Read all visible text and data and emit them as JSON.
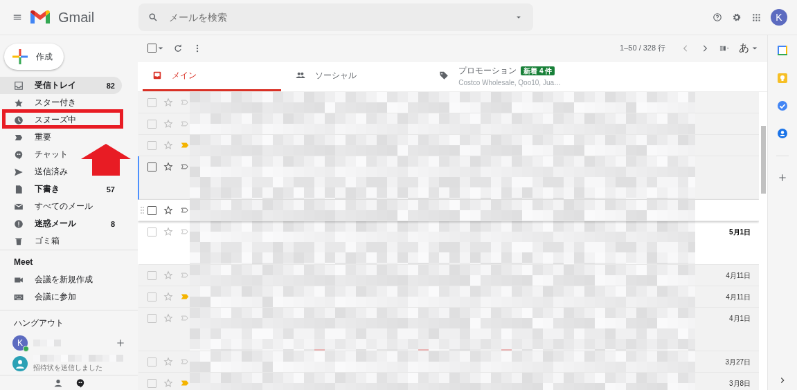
{
  "app": {
    "title": "Gmail"
  },
  "search": {
    "placeholder": "メールを検索"
  },
  "account": {
    "initial": "K"
  },
  "compose": {
    "label": "作成"
  },
  "nav": [
    {
      "kind": "inbox",
      "label": "受信トレイ",
      "count": "82",
      "selected": true,
      "unread": true
    },
    {
      "kind": "star",
      "label": "スター付き",
      "selected": false,
      "unread": false
    },
    {
      "kind": "snooze",
      "label": "スヌーズ中",
      "selected": false,
      "unread": false
    },
    {
      "kind": "important",
      "label": "重要",
      "selected": false,
      "unread": false
    },
    {
      "kind": "chat",
      "label": "チャット",
      "selected": false,
      "unread": false
    },
    {
      "kind": "sent",
      "label": "送信済み",
      "selected": false,
      "unread": false
    },
    {
      "kind": "draft",
      "label": "下書き",
      "count": "57",
      "selected": false,
      "unread": true
    },
    {
      "kind": "all",
      "label": "すべてのメール",
      "selected": false,
      "unread": false
    },
    {
      "kind": "spam",
      "label": "迷惑メール",
      "count": "8",
      "selected": false,
      "unread": true
    },
    {
      "kind": "trash",
      "label": "ゴミ箱",
      "selected": false,
      "unread": false
    }
  ],
  "meet": {
    "title": "Meet",
    "items": [
      {
        "kind": "video",
        "label": "会議を新規作成"
      },
      {
        "kind": "keyboard",
        "label": "会議に参加"
      }
    ]
  },
  "hangouts": {
    "title": "ハングアウト",
    "contacts": [
      {
        "kind": "self",
        "initial": "K",
        "online": true
      },
      {
        "kind": "invited",
        "status": "招待状を送信しました",
        "online": false
      }
    ]
  },
  "toolbar": {
    "select_all": false,
    "range": "1–50 / 328 行",
    "input_tool": "あ"
  },
  "tabs": [
    {
      "kind": "primary",
      "label": "メイン",
      "selected": true
    },
    {
      "kind": "social",
      "label": "ソーシャル",
      "selected": false
    },
    {
      "kind": "promotions",
      "label": "プロモーション",
      "badge": "新着 4 件",
      "subtitle": "Costco Wholesale, Qoo10, Jua…",
      "selected": false
    }
  ],
  "rows": [
    {
      "kind": "single",
      "important": false,
      "unread": false,
      "focused": false,
      "hovered": false
    },
    {
      "kind": "single",
      "important": false,
      "unread": false,
      "focused": false,
      "hovered": false
    },
    {
      "kind": "single",
      "important": true,
      "unread": false,
      "focused": false,
      "hovered": false
    },
    {
      "kind": "attachments",
      "important": false,
      "unread": false,
      "focused": true,
      "hovered": false
    },
    {
      "kind": "single",
      "important": false,
      "unread": false,
      "focused": false,
      "hovered": true
    },
    {
      "kind": "attachments",
      "important": false,
      "unread": true,
      "focused": false,
      "hovered": false,
      "date": "5月1日"
    },
    {
      "kind": "single",
      "important": false,
      "unread": false,
      "focused": false,
      "hovered": false,
      "date": "4月11日"
    },
    {
      "kind": "single",
      "important": true,
      "unread": false,
      "focused": false,
      "hovered": false,
      "date": "4月11日"
    },
    {
      "kind": "attachments",
      "important": false,
      "unread": false,
      "focused": false,
      "hovered": false,
      "date": "4月1日"
    },
    {
      "kind": "single",
      "important": false,
      "unread": false,
      "focused": false,
      "hovered": false,
      "date": "3月27日"
    },
    {
      "kind": "single",
      "important": true,
      "unread": false,
      "focused": false,
      "hovered": false,
      "date": "3月8日"
    }
  ]
}
